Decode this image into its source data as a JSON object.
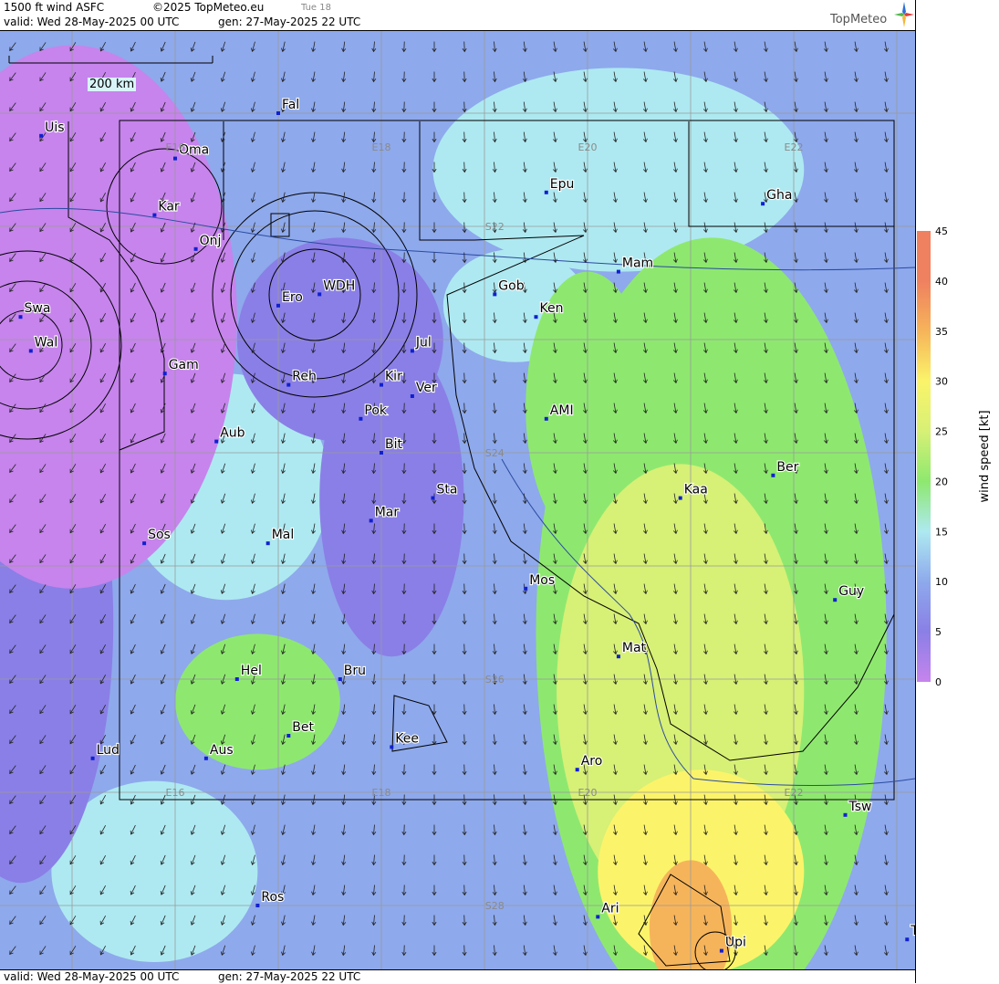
{
  "header": {
    "product": "1500 ft wind ASFC",
    "copyright": "©2025 TopMeteo.eu",
    "day_tag": "Tue 18",
    "valid": "valid:  Wed  28-May-2025  00 UTC",
    "gen": "gen: 27-May-2025 22 UTC"
  },
  "footer": {
    "valid": "valid:  Wed  28-May-2025  00 UTC",
    "gen": "gen: 27-May-2025 22 UTC"
  },
  "logo": {
    "text": "TopMeteo",
    "icon": "compass-star-icon"
  },
  "scalebar": {
    "label": "200 km"
  },
  "grid_labels": [
    {
      "text": "E16",
      "lon": 16,
      "lat": -21.3
    },
    {
      "text": "E18",
      "lon": 18,
      "lat": -21.3
    },
    {
      "text": "E20",
      "lon": 20,
      "lat": -21.3
    },
    {
      "text": "E22",
      "lon": 22,
      "lat": -21.3
    },
    {
      "text": "S22",
      "lon": 19.1,
      "lat": -22.0
    },
    {
      "text": "S24",
      "lon": 19.1,
      "lat": -24.0
    },
    {
      "text": "S26",
      "lon": 19.1,
      "lat": -26.0
    },
    {
      "text": "S28",
      "lon": 19.1,
      "lat": -28.0
    },
    {
      "text": "E16",
      "lon": 16,
      "lat": -27.0
    },
    {
      "text": "E18",
      "lon": 18,
      "lat": -27.0
    },
    {
      "text": "E20",
      "lon": 20,
      "lat": -27.0
    },
    {
      "text": "E22",
      "lon": 22,
      "lat": -27.0
    }
  ],
  "stations": [
    {
      "name": "Uis",
      "lon": 14.7,
      "lat": -21.2
    },
    {
      "name": "Fal",
      "lon": 17.0,
      "lat": -21.0
    },
    {
      "name": "Oma",
      "lon": 16.0,
      "lat": -21.4
    },
    {
      "name": "Kar",
      "lon": 15.8,
      "lat": -21.9
    },
    {
      "name": "Epu",
      "lon": 19.6,
      "lat": -21.7
    },
    {
      "name": "Gha",
      "lon": 21.7,
      "lat": -21.8
    },
    {
      "name": "Onj",
      "lon": 16.2,
      "lat": -22.2
    },
    {
      "name": "Gob",
      "lon": 19.1,
      "lat": -22.6
    },
    {
      "name": "Mam",
      "lon": 20.3,
      "lat": -22.4
    },
    {
      "name": "Ken",
      "lon": 19.5,
      "lat": -22.8
    },
    {
      "name": "Swa",
      "lon": 14.5,
      "lat": -22.8
    },
    {
      "name": "WDH",
      "lon": 17.4,
      "lat": -22.6
    },
    {
      "name": "Ero",
      "lon": 17.0,
      "lat": -22.7
    },
    {
      "name": "Wal",
      "lon": 14.6,
      "lat": -23.1
    },
    {
      "name": "Jul",
      "lon": 18.3,
      "lat": -23.1
    },
    {
      "name": "Gam",
      "lon": 15.9,
      "lat": -23.3
    },
    {
      "name": "Reh",
      "lon": 17.1,
      "lat": -23.4
    },
    {
      "name": "Kir",
      "lon": 18.0,
      "lat": -23.4
    },
    {
      "name": "Ver",
      "lon": 18.3,
      "lat": -23.5
    },
    {
      "name": "AMI",
      "lon": 19.6,
      "lat": -23.7
    },
    {
      "name": "Pok",
      "lon": 17.8,
      "lat": -23.7
    },
    {
      "name": "Aub",
      "lon": 16.4,
      "lat": -23.9
    },
    {
      "name": "Bit",
      "lon": 18.0,
      "lat": -24.0
    },
    {
      "name": "Ber",
      "lon": 21.8,
      "lat": -24.2
    },
    {
      "name": "Kaa",
      "lon": 20.9,
      "lat": -24.4
    },
    {
      "name": "Sta",
      "lon": 18.5,
      "lat": -24.4
    },
    {
      "name": "Mar",
      "lon": 17.9,
      "lat": -24.6
    },
    {
      "name": "Sos",
      "lon": 15.7,
      "lat": -24.8
    },
    {
      "name": "Mal",
      "lon": 16.9,
      "lat": -24.8
    },
    {
      "name": "Mos",
      "lon": 19.4,
      "lat": -25.2
    },
    {
      "name": "Guy",
      "lon": 22.4,
      "lat": -25.3
    },
    {
      "name": "Mat",
      "lon": 20.3,
      "lat": -25.8
    },
    {
      "name": "Hel",
      "lon": 16.6,
      "lat": -26.0
    },
    {
      "name": "Bru",
      "lon": 17.6,
      "lat": -26.0
    },
    {
      "name": "Bet",
      "lon": 17.1,
      "lat": -26.5
    },
    {
      "name": "Kee",
      "lon": 18.1,
      "lat": -26.6
    },
    {
      "name": "Lud",
      "lon": 15.2,
      "lat": -26.7
    },
    {
      "name": "Aus",
      "lon": 16.3,
      "lat": -26.7
    },
    {
      "name": "Aro",
      "lon": 19.9,
      "lat": -26.8
    },
    {
      "name": "Tsw",
      "lon": 22.5,
      "lat": -27.2
    },
    {
      "name": "Ros",
      "lon": 16.8,
      "lat": -28.0
    },
    {
      "name": "Ari",
      "lon": 20.1,
      "lat": -28.1
    },
    {
      "name": "Upi",
      "lon": 21.3,
      "lat": -28.4
    },
    {
      "name": "To",
      "lon": 23.1,
      "lat": -28.3
    }
  ],
  "wind_speed_field": {
    "background_kt": 13,
    "zones": [
      {
        "lon": 15.0,
        "lat": -22.8,
        "rx": 1.6,
        "ry": 2.4,
        "kt": 4
      },
      {
        "lon": 14.5,
        "lat": -25.5,
        "rx": 0.9,
        "ry": 2.3,
        "kt": 6
      },
      {
        "lon": 14.8,
        "lat": -21.8,
        "rx": 1.2,
        "ry": 0.8,
        "kt": 7
      },
      {
        "lon": 17.6,
        "lat": -23.0,
        "rx": 1.0,
        "ry": 0.9,
        "kt": 9
      },
      {
        "lon": 18.1,
        "lat": -24.4,
        "rx": 0.7,
        "ry": 1.4,
        "kt": 7
      },
      {
        "lon": 20.3,
        "lat": -21.5,
        "rx": 1.8,
        "ry": 0.9,
        "kt": 17
      },
      {
        "lon": 19.3,
        "lat": -22.7,
        "rx": 0.7,
        "ry": 0.5,
        "kt": 16
      },
      {
        "lon": 16.5,
        "lat": -24.3,
        "rx": 1.0,
        "ry": 1.0,
        "kt": 16
      },
      {
        "lon": 15.8,
        "lat": -27.7,
        "rx": 1.0,
        "ry": 0.8,
        "kt": 17
      },
      {
        "lon": 21.2,
        "lat": -25.6,
        "rx": 1.7,
        "ry": 3.5,
        "kt": 21
      },
      {
        "lon": 20.0,
        "lat": -23.6,
        "rx": 0.6,
        "ry": 1.2,
        "kt": 23
      },
      {
        "lon": 16.8,
        "lat": -26.2,
        "rx": 0.8,
        "ry": 0.6,
        "kt": 21
      },
      {
        "lon": 20.9,
        "lat": -26.1,
        "rx": 1.2,
        "ry": 2.0,
        "kt": 27
      },
      {
        "lon": 21.1,
        "lat": -27.7,
        "rx": 1.0,
        "ry": 0.9,
        "kt": 31
      },
      {
        "lon": 21.0,
        "lat": -28.2,
        "rx": 0.4,
        "ry": 0.6,
        "kt": 38
      }
    ]
  },
  "legend": {
    "title": "wind speed [kt]",
    "min": 0,
    "max": 45,
    "ticks": [
      "45",
      "40",
      "35",
      "30",
      "25",
      "20",
      "15",
      "10",
      "5",
      "0"
    ],
    "stops": [
      {
        "kt": 0,
        "color": "#c684ec"
      },
      {
        "kt": 5,
        "color": "#8a7fe6"
      },
      {
        "kt": 10,
        "color": "#8ea9ec"
      },
      {
        "kt": 15,
        "color": "#aee9f1"
      },
      {
        "kt": 20,
        "color": "#8ee86f"
      },
      {
        "kt": 25,
        "color": "#d7f076"
      },
      {
        "kt": 30,
        "color": "#fbf46a"
      },
      {
        "kt": 35,
        "color": "#f6b45a"
      },
      {
        "kt": 40,
        "color": "#ef8060"
      },
      {
        "kt": 45,
        "color": "#ef8060"
      }
    ]
  }
}
